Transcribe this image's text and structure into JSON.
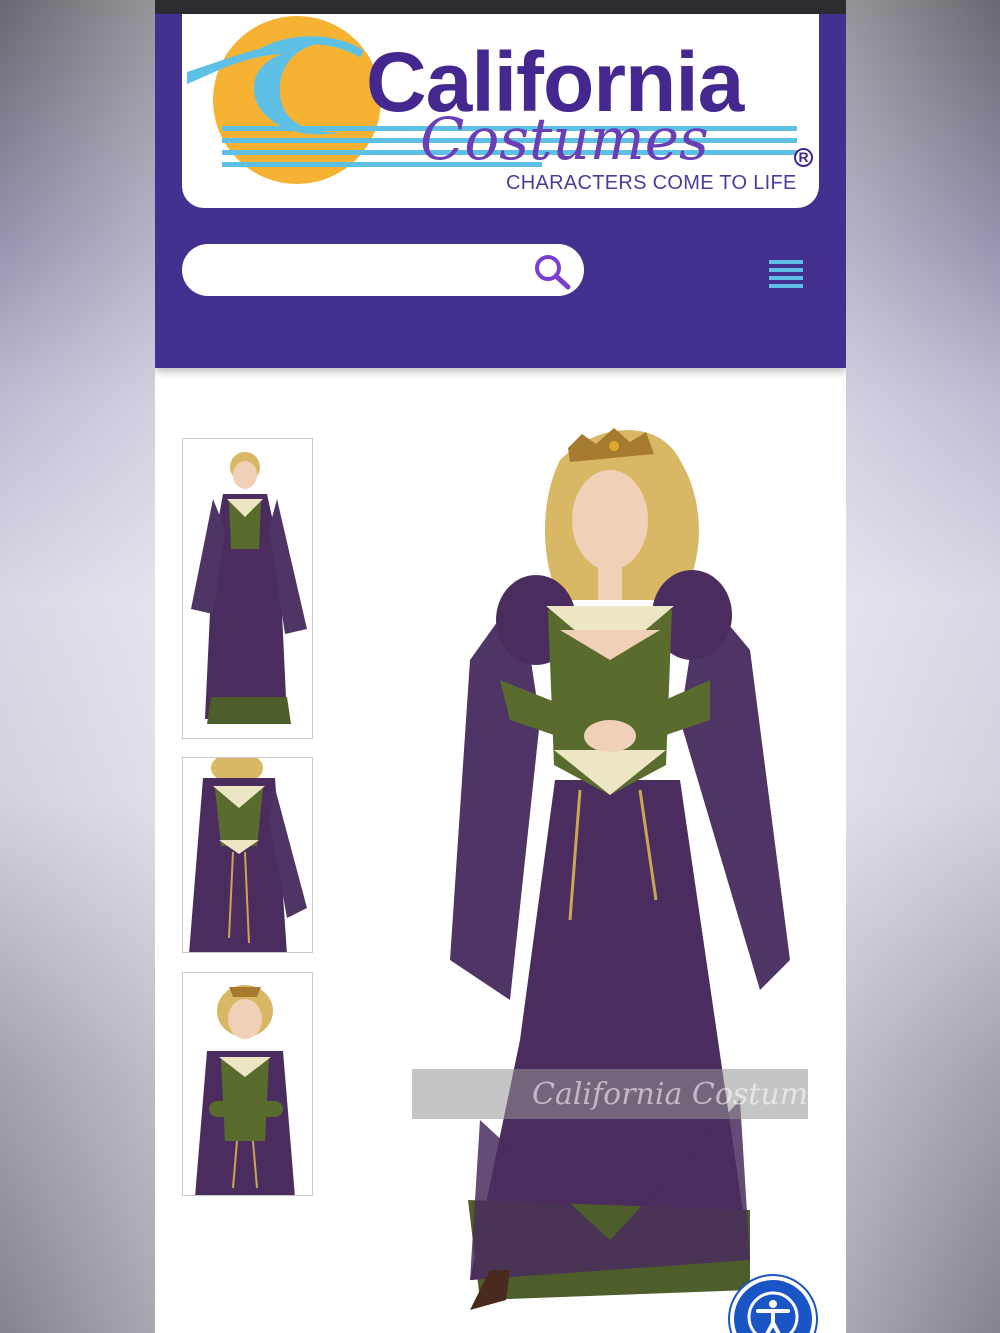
{
  "brand": {
    "name": "California",
    "script": "Costumes",
    "registered": "R",
    "tagline": "CHARACTERS COME TO LIFE",
    "colors": {
      "header": "#44308f",
      "logo_purple": "#45288f",
      "sun": "#f5b233",
      "wave": "#5fc0e6"
    }
  },
  "search": {
    "placeholder": "",
    "value": "",
    "icon": "search-icon"
  },
  "menu": {
    "icon": "hamburger-menu-icon"
  },
  "gallery": {
    "thumbnails": [
      {
        "name": "full-length-front-view"
      },
      {
        "name": "bodice-detail-view"
      },
      {
        "name": "upper-body-view"
      }
    ],
    "main_image": "lady-in-waiting-purple-gown",
    "watermark": "California Costumes"
  },
  "accessibility": {
    "icon": "accessibility-icon"
  }
}
